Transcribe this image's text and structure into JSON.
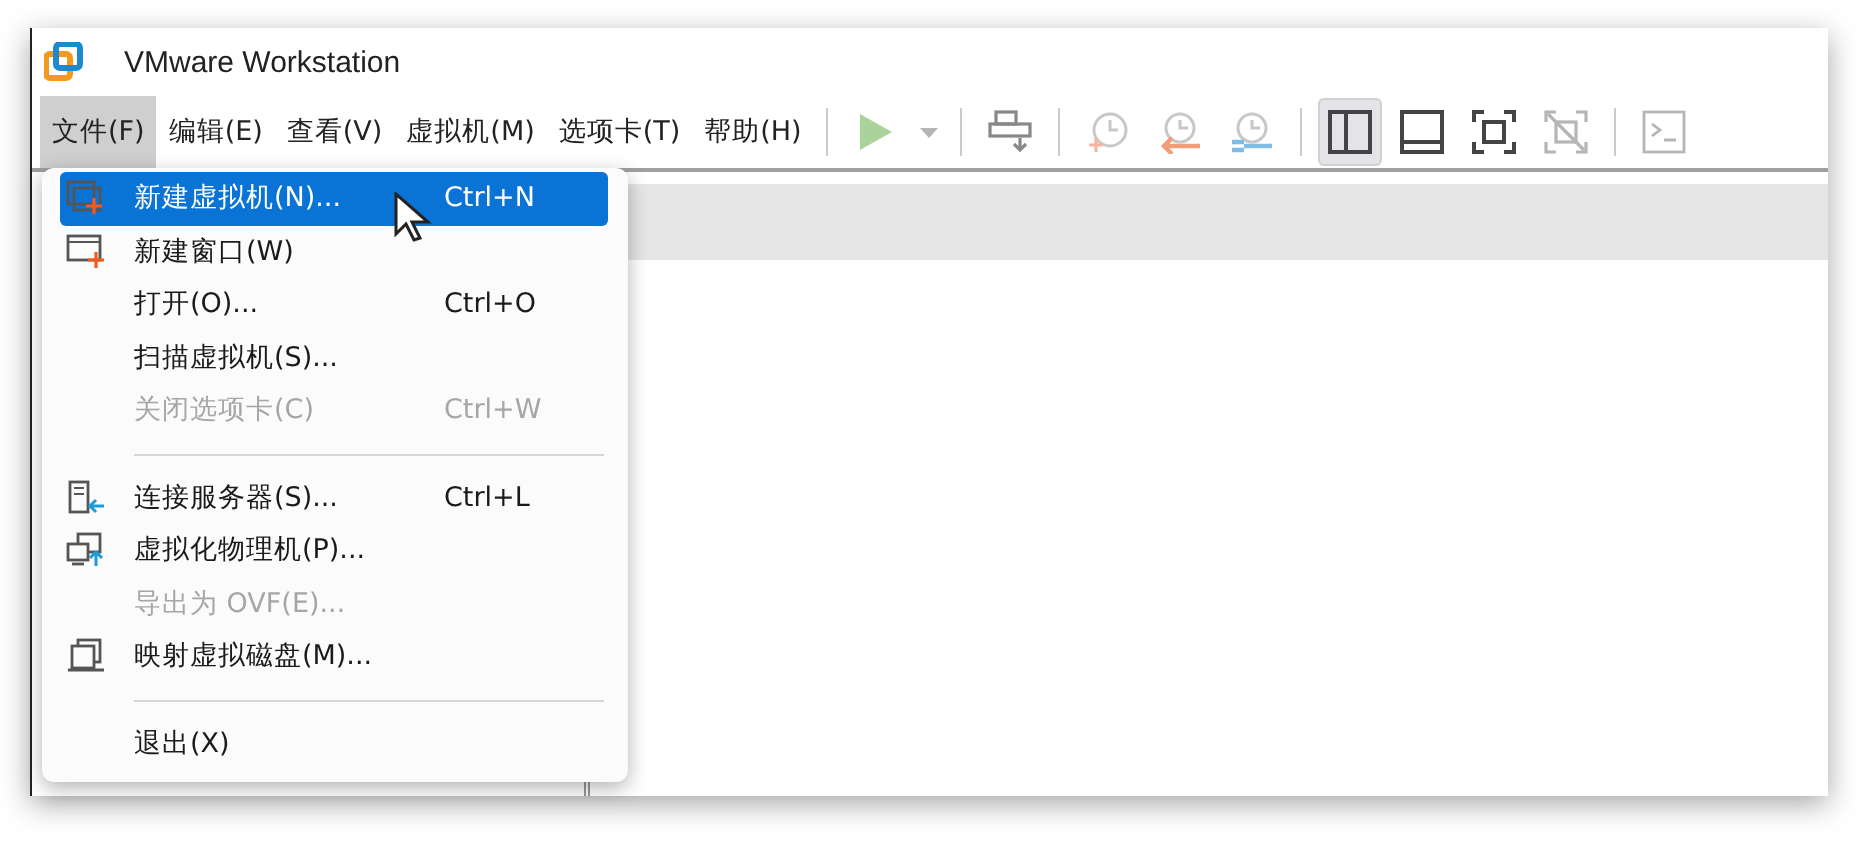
{
  "window": {
    "title": "VMware Workstation"
  },
  "menu_bar": [
    {
      "label": "文件(F)",
      "selected": true
    },
    {
      "label": "编辑(E)",
      "selected": false
    },
    {
      "label": "查看(V)",
      "selected": false
    },
    {
      "label": "虚拟机(M)",
      "selected": false
    },
    {
      "label": "选项卡(T)",
      "selected": false
    },
    {
      "label": "帮助(H)",
      "selected": false
    }
  ],
  "toolbar": [
    {
      "kind": "separator"
    },
    {
      "kind": "play",
      "disabled": true,
      "selected": false
    },
    {
      "kind": "caret",
      "disabled": true,
      "selected": false
    },
    {
      "kind": "separator"
    },
    {
      "kind": "send-keys",
      "disabled": true,
      "selected": false
    },
    {
      "kind": "separator"
    },
    {
      "kind": "snapshot-take",
      "disabled": true,
      "selected": false
    },
    {
      "kind": "snapshot-revert",
      "disabled": true,
      "selected": false
    },
    {
      "kind": "snapshot-manage",
      "disabled": true,
      "selected": false
    },
    {
      "kind": "separator"
    },
    {
      "kind": "view-library",
      "disabled": false,
      "selected": true
    },
    {
      "kind": "view-thumbnail",
      "disabled": false,
      "selected": false
    },
    {
      "kind": "view-fullscreen",
      "disabled": false,
      "selected": false
    },
    {
      "kind": "view-unity",
      "disabled": true,
      "selected": false
    },
    {
      "kind": "separator"
    },
    {
      "kind": "console",
      "disabled": true,
      "selected": false
    }
  ],
  "file_menu": [
    {
      "kind": "new-vm",
      "label": "新建虚拟机(N)...",
      "shortcut": "Ctrl+N",
      "disabled": false,
      "selected": true
    },
    {
      "kind": "new-window",
      "label": "新建窗口(W)",
      "disabled": false,
      "selected": false
    },
    {
      "kind": "plain",
      "label": "打开(O)...",
      "shortcut": "Ctrl+O",
      "disabled": false,
      "selected": false
    },
    {
      "kind": "plain",
      "label": "扫描虚拟机(S)...",
      "disabled": false,
      "selected": false
    },
    {
      "kind": "plain",
      "label": "关闭选项卡(C)",
      "shortcut": "Ctrl+W",
      "disabled": true,
      "selected": false
    },
    {
      "kind": "separator"
    },
    {
      "kind": "connect",
      "label": "连接服务器(S)...",
      "shortcut": "Ctrl+L",
      "disabled": false,
      "selected": false
    },
    {
      "kind": "physical",
      "label": "虚拟化物理机(P)...",
      "disabled": false,
      "selected": false
    },
    {
      "kind": "plain",
      "label": "导出为 OVF(E)...",
      "disabled": true,
      "selected": false
    },
    {
      "kind": "map-disk",
      "label": "映射虚拟磁盘(M)...",
      "disabled": false,
      "selected": false
    },
    {
      "kind": "separator"
    },
    {
      "kind": "plain",
      "label": "退出(X)",
      "disabled": false,
      "selected": false
    }
  ]
}
